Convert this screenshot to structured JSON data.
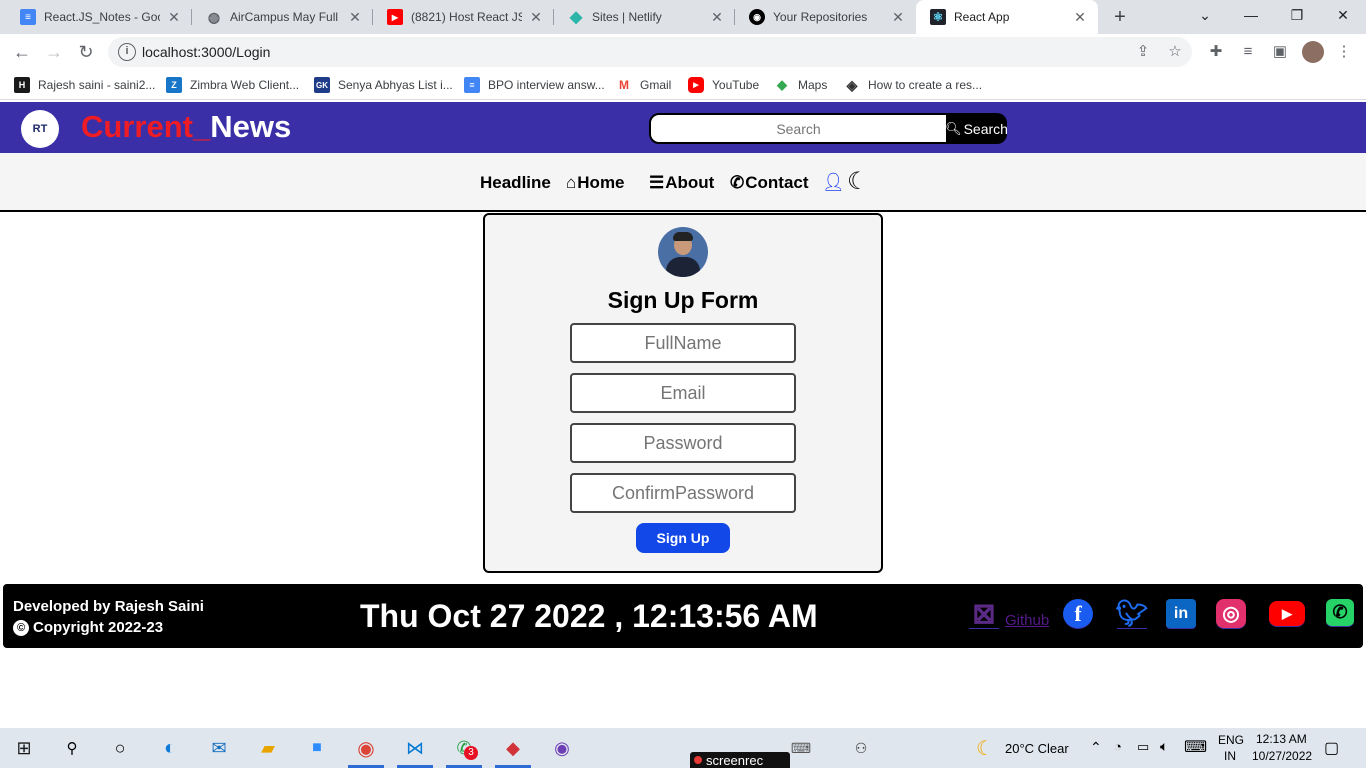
{
  "browser": {
    "tabs": [
      {
        "title": "React.JS_Notes - Goog",
        "icon": "google-docs-icon",
        "color": "#4285f4"
      },
      {
        "title": "AirCampus May Full St",
        "icon": "globe-icon",
        "color": "#5f6368"
      },
      {
        "title": "(8821) Host React JS W",
        "icon": "youtube-icon",
        "color": "#ff0000"
      },
      {
        "title": "Sites | Netlify",
        "icon": "netlify-icon",
        "color": "#2bb5a8"
      },
      {
        "title": "Your Repositories",
        "icon": "github-icon",
        "color": "#000000"
      },
      {
        "title": "React App",
        "icon": "react-icon",
        "color": "#61dafb"
      }
    ],
    "url": "localhost:3000/Login",
    "bookmarks": [
      {
        "label": "Rajesh saini - saini2...",
        "icon": "hackerrank-icon",
        "color": "#1a1a1a",
        "glyph": "H"
      },
      {
        "label": "Zimbra Web Client...",
        "icon": "zimbra-icon",
        "color": "#1776c8",
        "glyph": "Z"
      },
      {
        "label": "Senya Abhyas List i...",
        "icon": "gk-icon",
        "color": "#1f3c88",
        "glyph": "GK"
      },
      {
        "label": "BPO interview answ...",
        "icon": "google-docs-icon",
        "color": "#4285f4",
        "glyph": "≡"
      },
      {
        "label": "Gmail",
        "icon": "gmail-icon",
        "color": "#ea4335",
        "glyph": "M"
      },
      {
        "label": "YouTube",
        "icon": "youtube-icon",
        "color": "#ff0000",
        "glyph": "▶"
      },
      {
        "label": "Maps",
        "icon": "maps-icon",
        "color": "#34a853",
        "glyph": "◆"
      },
      {
        "label": "How to create a res...",
        "icon": "codepen-icon",
        "color": "#333333",
        "glyph": "◈"
      }
    ]
  },
  "header": {
    "brand_part1": "Current_",
    "brand_part2": "News",
    "search_placeholder": "Search",
    "search_button": "Search"
  },
  "nav": {
    "headline": "Headline",
    "home": "Home",
    "about": "About",
    "contact": "Contact"
  },
  "form": {
    "title": "Sign Up Form",
    "fullname_placeholder": "FullName",
    "email_placeholder": "Email",
    "password_placeholder": "Password",
    "confirm_placeholder": "ConfirmPassword",
    "submit": "Sign Up"
  },
  "footer": {
    "developer": "Developed by Rajesh Saini",
    "copyright": "Copyright 2022-23",
    "datetime": "Thu Oct 27 2022 , 12:13:56 AM",
    "github_label": "Github",
    "socials": [
      {
        "icon": "x-icon",
        "color": "#5b2a86",
        "glyph": "⊠"
      },
      {
        "icon": "facebook-icon",
        "color": "#1a5cf0",
        "glyph": "f"
      },
      {
        "icon": "twitter-icon",
        "color": "#1d6cf2",
        "glyph": "🐦"
      },
      {
        "icon": "linkedin-icon",
        "color": "#0a66c2",
        "glyph": "in"
      },
      {
        "icon": "instagram-icon",
        "color": "#e1306c",
        "glyph": "◎"
      },
      {
        "icon": "youtube-icon",
        "color": "#ff0000",
        "glyph": "▶"
      },
      {
        "icon": "whatsapp-icon",
        "color": "#25d366",
        "glyph": "✆"
      }
    ]
  },
  "taskbar": {
    "screenrec": "screenrec",
    "weather": "20°C  Clear",
    "lang_top": "ENG",
    "lang_bottom": "IN",
    "time": "12:13 AM",
    "date": "10/27/2022",
    "chat_badge": "3"
  }
}
